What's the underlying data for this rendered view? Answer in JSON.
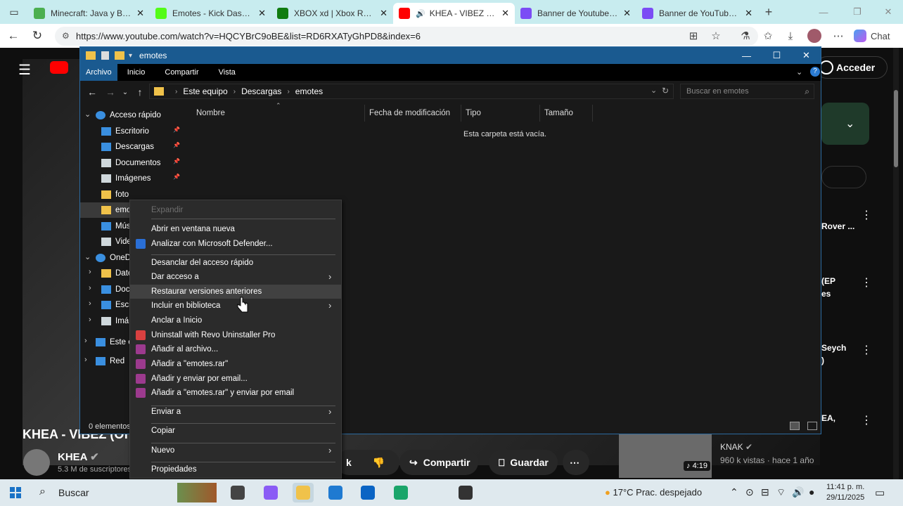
{
  "browser": {
    "tabs": [
      {
        "title": "Minecraft: Java y Bedrock",
        "icon": "minecraft-icon",
        "color": "#4caf50"
      },
      {
        "title": "Emotes - Kick Dashboard",
        "icon": "kick-icon",
        "color": "#53fc18"
      },
      {
        "title": "XBOX xd | Xbox Remote",
        "icon": "xbox-icon",
        "color": "#107c10"
      },
      {
        "title": "KHEA - VIBEZ (Official",
        "icon": "youtube-icon",
        "color": "#ff0000",
        "active": true
      },
      {
        "title": "Banner de Youtube Gaming",
        "icon": "canva-icon",
        "color": "#7b4cf5"
      },
      {
        "title": "Banner de YouTube para",
        "icon": "canva-icon",
        "color": "#7b4cf5"
      }
    ],
    "url": "https://www.youtube.com/watch?v=HQCYBrC9oBE&list=RD6RXATyGhPD8&index=6",
    "copilot_label": "Chat"
  },
  "youtube": {
    "acceder": "Acceder",
    "video_title": "KHEA - VIBEZ (Of",
    "channel": "KHEA",
    "subscribers": "5.3 M de suscriptores",
    "buttons": {
      "dislike_left": "k",
      "share": "Compartir",
      "save": "Guardar"
    },
    "sidebar": [
      {
        "text": "Rover ..."
      },
      {
        "text": "(EP"
      },
      {
        "text": "es"
      },
      {
        "text": "Seych"
      },
      {
        "text": ")"
      },
      {
        "text": "EA,"
      }
    ],
    "rec_channel": "KNAK",
    "rec_meta": "960 k vistas · hace 1 año",
    "rec_duration": "4:19"
  },
  "explorer": {
    "title": "emotes",
    "ribbon": [
      "Archivo",
      "Inicio",
      "Compartir",
      "Vista"
    ],
    "path": [
      "Este equipo",
      "Descargas",
      "emotes"
    ],
    "search_placeholder": "Buscar en emotes",
    "nav": [
      {
        "label": "Acceso rápido",
        "icon": "star-icon",
        "color": "#3a8fe0",
        "level": 0,
        "expanded": true
      },
      {
        "label": "Escritorio",
        "icon": "desktop-icon",
        "color": "#3a8fe0",
        "level": 1,
        "pinned": true
      },
      {
        "label": "Descargas",
        "icon": "download-icon",
        "color": "#3a8fe0",
        "level": 1,
        "pinned": true
      },
      {
        "label": "Documentos",
        "icon": "document-icon",
        "color": "#cfd8dc",
        "level": 1,
        "pinned": true
      },
      {
        "label": "Imágenes",
        "icon": "picture-icon",
        "color": "#cfd8dc",
        "level": 1,
        "pinned": true
      },
      {
        "label": "foto",
        "icon": "folder-icon",
        "color": "#f0c24a",
        "level": 1
      },
      {
        "label": "emo",
        "icon": "folder-icon",
        "color": "#f0c24a",
        "level": 1,
        "selected": true
      },
      {
        "label": "Mús",
        "icon": "music-icon",
        "color": "#3a8fe0",
        "level": 1
      },
      {
        "label": "Vide",
        "icon": "video-icon",
        "color": "#cfd8dc",
        "level": 1
      },
      {
        "label": "OneD",
        "icon": "onedrive-icon",
        "color": "#3a8fe0",
        "level": 0,
        "expanded": true
      },
      {
        "label": "Date",
        "icon": "folder-icon",
        "color": "#f0c24a",
        "level": 1
      },
      {
        "label": "Doc",
        "icon": "folder-icon",
        "color": "#3a8fe0",
        "level": 1
      },
      {
        "label": "Escr",
        "icon": "desktop-icon",
        "color": "#3a8fe0",
        "level": 1
      },
      {
        "label": "Imá",
        "icon": "picture-icon",
        "color": "#cfd8dc",
        "level": 1
      },
      {
        "label": "Este e",
        "icon": "computer-icon",
        "color": "#3a8fe0",
        "level": 0
      },
      {
        "label": "Red",
        "icon": "network-icon",
        "color": "#3a8fe0",
        "level": 0
      }
    ],
    "columns": [
      "Nombre",
      "Fecha de modificación",
      "Tipo",
      "Tamaño"
    ],
    "empty_text": "Esta carpeta está vacía.",
    "status": "0 elementos"
  },
  "context_menu": {
    "items": [
      {
        "label": "Expandir",
        "disabled": true
      },
      {
        "sep": true
      },
      {
        "label": "Abrir en ventana nueva"
      },
      {
        "label": "Analizar con Microsoft Defender...",
        "icon": "defender-icon",
        "color": "#2a6fd6"
      },
      {
        "sep": true
      },
      {
        "label": "Desanclar del acceso rápido"
      },
      {
        "label": "Dar acceso a",
        "submenu": true
      },
      {
        "label": "Restaurar versiones anteriores",
        "hover": true
      },
      {
        "label": "Incluir en biblioteca",
        "submenu": true
      },
      {
        "label": "Anclar a Inicio"
      },
      {
        "label": "Uninstall with Revo Uninstaller Pro",
        "icon": "revo-icon",
        "color": "#d94040"
      },
      {
        "label": "Añadir al archivo...",
        "icon": "winrar-icon",
        "color": "#9c3a8e"
      },
      {
        "label": "Añadir a \"emotes.rar\"",
        "icon": "winrar-icon",
        "color": "#9c3a8e"
      },
      {
        "label": "Añadir y enviar por email...",
        "icon": "winrar-icon",
        "color": "#9c3a8e"
      },
      {
        "label": "Añadir a \"emotes.rar\" y enviar por email",
        "icon": "winrar-icon",
        "color": "#9c3a8e"
      },
      {
        "sep": true
      },
      {
        "label": "Enviar a",
        "submenu": true
      },
      {
        "sep": true
      },
      {
        "label": "Copiar"
      },
      {
        "sep": true
      },
      {
        "label": "Nuevo",
        "submenu": true
      },
      {
        "sep": true
      },
      {
        "label": "Propiedades"
      }
    ]
  },
  "taskbar": {
    "search": "Buscar",
    "apps": [
      {
        "icon": "task-view-icon",
        "color": "#444444"
      },
      {
        "icon": "copilot-icon",
        "color": "#8a5cf5"
      },
      {
        "icon": "file-explorer-icon",
        "color": "#f0c24a",
        "active": true
      },
      {
        "icon": "store-icon",
        "color": "#1f7ad1"
      },
      {
        "icon": "outlook-icon",
        "color": "#0a64c4"
      },
      {
        "icon": "edge-icon",
        "color": "#1aa56a"
      },
      {
        "icon": "obs-icon",
        "color": "#333333"
      }
    ],
    "weather": "17°C  Prac. despejado",
    "time": "11:41 p. m.",
    "date": "29/11/2025"
  }
}
